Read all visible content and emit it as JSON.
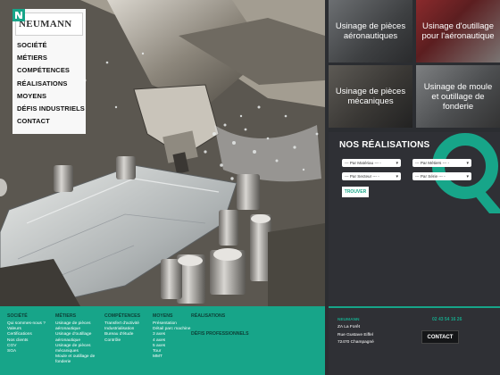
{
  "brand": {
    "name": "NEUMANN"
  },
  "menu": [
    "SOCIÉTÉ",
    "MÉTIERS",
    "COMPÉTENCES",
    "RÉALISATIONS",
    "MOYENS",
    "DÉFIS INDUSTRIELS",
    "CONTACT"
  ],
  "tiles": [
    {
      "label": "Usinage de pièces aéronautiques"
    },
    {
      "label": "Usinage d'outillage pour l'aéronautique"
    },
    {
      "label": "Usinage de pièces mécaniques"
    },
    {
      "label": "Usinage de moule et outillage de fonderie"
    }
  ],
  "realisations": {
    "title": "NOS RÉALISATIONS",
    "selects": [
      "--- Par Matériau --- -",
      "--- Par Métiers --- -",
      "--- Par Secteur --- -",
      "--- Par Série --- -"
    ],
    "button": "TROUVER"
  },
  "footer": {
    "columns": [
      {
        "title": "SOCIÉTÉ",
        "links": [
          "Qui sommes-nous ?",
          "Valeurs",
          "Certifications",
          "Nos clients",
          "CGV",
          "SGA"
        ]
      },
      {
        "title": "MÉTIERS",
        "links": [
          "Usinage de pièces",
          "aéronautique",
          "Usinage d'outillage",
          "aéronautique",
          "Usinage de pièces",
          "mécaniques",
          "Moule et outillage de",
          "fonderie"
        ]
      },
      {
        "title": "COMPÉTENCES",
        "links": [
          "Transfert d'activité",
          "Industrialisation",
          "Bureau d'étude",
          "Contrôle"
        ]
      },
      {
        "title": "MOYENS",
        "links": [
          "Présentation",
          "Détail parc machine",
          "3 axes",
          "4 axes",
          "5 axes",
          "Tour",
          "MMT"
        ]
      },
      {
        "title": "RÉALISATIONS",
        "links": []
      }
    ],
    "defis": "DÉFIS PROFESSIONNELS",
    "address": {
      "name": "NEUMANN",
      "line1": "ZA La Forêt",
      "line2": "Rue Gustave Eiffel",
      "line3": "72470 Champagné"
    },
    "phone": "02 43 54 16 26",
    "contact_button": "CONTACT"
  },
  "colors": {
    "accent": "#17a589",
    "dark": "#2f3035"
  }
}
